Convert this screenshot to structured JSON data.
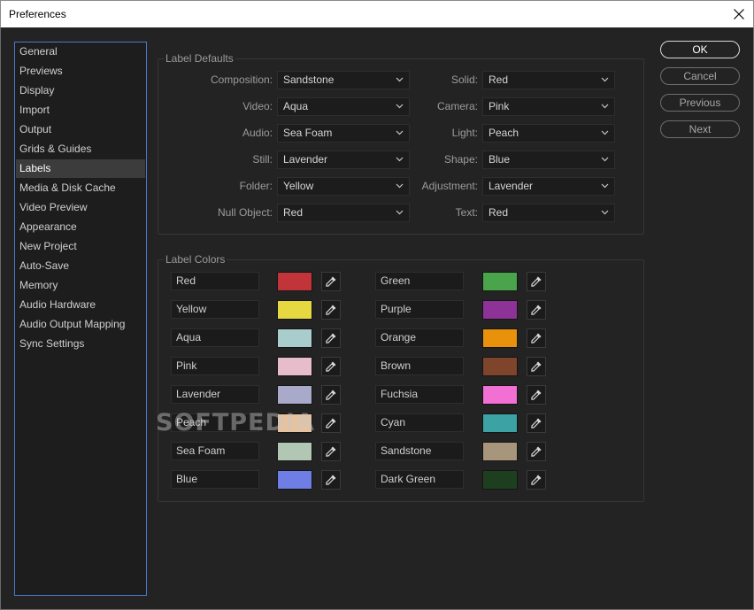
{
  "window": {
    "title": "Preferences"
  },
  "sidebar": {
    "items": [
      {
        "label": "General"
      },
      {
        "label": "Previews"
      },
      {
        "label": "Display"
      },
      {
        "label": "Import"
      },
      {
        "label": "Output"
      },
      {
        "label": "Grids & Guides"
      },
      {
        "label": "Labels",
        "selected": true
      },
      {
        "label": "Media & Disk Cache"
      },
      {
        "label": "Video Preview"
      },
      {
        "label": "Appearance"
      },
      {
        "label": "New Project"
      },
      {
        "label": "Auto-Save"
      },
      {
        "label": "Memory"
      },
      {
        "label": "Audio Hardware"
      },
      {
        "label": "Audio Output Mapping"
      },
      {
        "label": "Sync Settings"
      }
    ]
  },
  "label_defaults": {
    "title": "Label Defaults",
    "left": [
      {
        "label": "Composition:",
        "value": "Sandstone"
      },
      {
        "label": "Video:",
        "value": "Aqua"
      },
      {
        "label": "Audio:",
        "value": "Sea Foam"
      },
      {
        "label": "Still:",
        "value": "Lavender"
      },
      {
        "label": "Folder:",
        "value": "Yellow"
      },
      {
        "label": "Null Object:",
        "value": "Red"
      }
    ],
    "right": [
      {
        "label": "Solid:",
        "value": "Red"
      },
      {
        "label": "Camera:",
        "value": "Pink"
      },
      {
        "label": "Light:",
        "value": "Peach"
      },
      {
        "label": "Shape:",
        "value": "Blue"
      },
      {
        "label": "Adjustment:",
        "value": "Lavender"
      },
      {
        "label": "Text:",
        "value": "Red"
      }
    ]
  },
  "label_colors": {
    "title": "Label Colors",
    "left": [
      {
        "name": "Red",
        "color": "#c0343a"
      },
      {
        "name": "Yellow",
        "color": "#e6d841"
      },
      {
        "name": "Aqua",
        "color": "#a9cdcc"
      },
      {
        "name": "Pink",
        "color": "#e7bccb"
      },
      {
        "name": "Lavender",
        "color": "#a9aac9"
      },
      {
        "name": "Peach",
        "color": "#e6c29f"
      },
      {
        "name": "Sea Foam",
        "color": "#b1c6b3"
      },
      {
        "name": "Blue",
        "color": "#6e7ee4"
      }
    ],
    "right": [
      {
        "name": "Green",
        "color": "#4aa44c"
      },
      {
        "name": "Purple",
        "color": "#8d3398"
      },
      {
        "name": "Orange",
        "color": "#e8920c"
      },
      {
        "name": "Brown",
        "color": "#7e442c"
      },
      {
        "name": "Fuchsia",
        "color": "#f270d3"
      },
      {
        "name": "Cyan",
        "color": "#3da2a4"
      },
      {
        "name": "Sandstone",
        "color": "#a8967c"
      },
      {
        "name": "Dark Green",
        "color": "#1e3f1f"
      }
    ]
  },
  "buttons": {
    "ok": "OK",
    "cancel": "Cancel",
    "previous": "Previous",
    "next": "Next"
  },
  "watermark": "SOFTPEDIA"
}
